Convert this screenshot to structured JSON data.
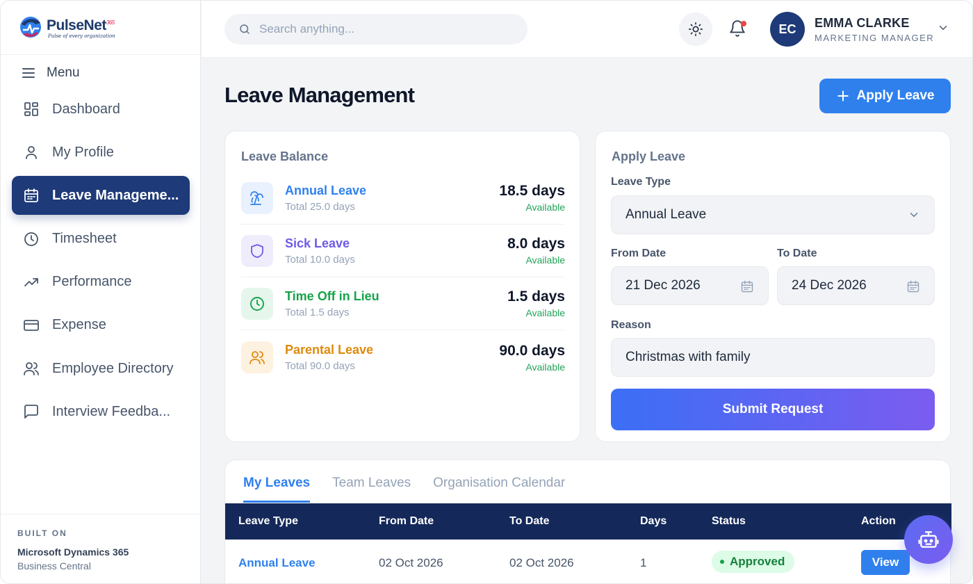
{
  "brand": {
    "name": "PulseNet",
    "superscript": "365",
    "tagline": "Pulse of every organization"
  },
  "sidebar": {
    "menu_label": "Menu",
    "items": [
      {
        "label": "Dashboard",
        "icon": "dashboard-icon",
        "active": false
      },
      {
        "label": "My Profile",
        "icon": "user-icon",
        "active": false
      },
      {
        "label": "Leave Manageme...",
        "icon": "calendar-icon",
        "active": true
      },
      {
        "label": "Timesheet",
        "icon": "clock-icon",
        "active": false
      },
      {
        "label": "Performance",
        "icon": "trending-up-icon",
        "active": false
      },
      {
        "label": "Expense",
        "icon": "credit-card-icon",
        "active": false
      },
      {
        "label": "Employee Directory",
        "icon": "users-icon",
        "active": false
      },
      {
        "label": "Interview Feedba...",
        "icon": "message-square-icon",
        "active": false
      }
    ],
    "built_on": {
      "label": "BUILT ON",
      "name": "Microsoft Dynamics 365",
      "sub": "Business Central"
    }
  },
  "topbar": {
    "search_placeholder": "Search anything...",
    "user": {
      "initials": "EC",
      "name": "EMMA CLARKE",
      "role": "MARKETING MANAGER"
    }
  },
  "page": {
    "title": "Leave Management",
    "apply_button": "Apply Leave"
  },
  "balance": {
    "title": "Leave Balance",
    "items": [
      {
        "name": "Annual Leave",
        "total": "Total 25.0 days",
        "days": "18.5 days",
        "status": "Available",
        "color": "#2f80ed",
        "bg": "#e8f1fd",
        "icon": "palm-tree-icon"
      },
      {
        "name": "Sick Leave",
        "total": "Total 10.0 days",
        "days": "8.0 days",
        "status": "Available",
        "color": "#6d5ae6",
        "bg": "#efecfc",
        "icon": "shield-icon"
      },
      {
        "name": "Time Off in Lieu",
        "total": "Total 1.5 days",
        "days": "1.5 days",
        "status": "Available",
        "color": "#16a34a",
        "bg": "#e6f6ec",
        "icon": "clock-icon"
      },
      {
        "name": "Parental Leave",
        "total": "Total 90.0 days",
        "days": "90.0 days",
        "status": "Available",
        "color": "#e08a0b",
        "bg": "#fdf1e0",
        "icon": "users-icon"
      }
    ]
  },
  "apply_form": {
    "title": "Apply Leave",
    "leave_type_label": "Leave Type",
    "leave_type_value": "Annual Leave",
    "from_label": "From Date",
    "from_value": "21 Dec 2026",
    "to_label": "To Date",
    "to_value": "24 Dec 2026",
    "reason_label": "Reason",
    "reason_value": "Christmas with family",
    "submit_label": "Submit Request"
  },
  "tabs": {
    "items": [
      "My Leaves",
      "Team Leaves",
      "Organisation Calendar"
    ],
    "active": 0
  },
  "table": {
    "headers": [
      "Leave Type",
      "From Date",
      "To Date",
      "Days",
      "Status",
      "Action"
    ],
    "rows": [
      {
        "type": "Annual Leave",
        "from": "02 Oct 2026",
        "to": "02 Oct 2026",
        "days": "1",
        "status": "Approved",
        "action": "View"
      }
    ]
  },
  "colors": {
    "primary": "#2f80ed",
    "navy": "#1e3a78",
    "table_header": "#14285a",
    "approved": "#16803d"
  }
}
